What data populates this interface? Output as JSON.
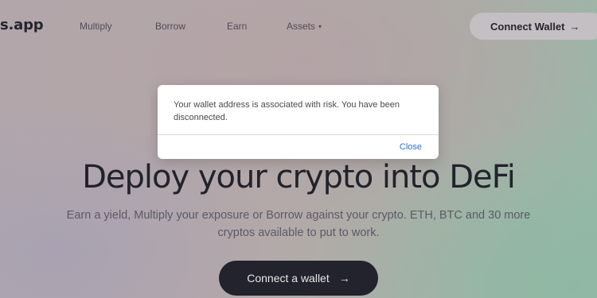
{
  "nav": {
    "logo": "s.app",
    "links": [
      "Multiply",
      "Borrow",
      "Earn",
      "Assets"
    ],
    "connect_wallet": "Connect Wallet",
    "connect_arrow": "→",
    "assets_chevron": "▾"
  },
  "hero": {
    "title": "Deploy your crypto into DeFi",
    "subtitle": "Earn a yield, Multiply your exposure or Borrow against your crypto. ETH, BTC and 30 more cryptos available to put to work.",
    "cta": "Connect a wallet",
    "cta_arrow": "→"
  },
  "modal": {
    "message": "Your wallet address is associated with risk. You have been disconnected.",
    "close": "Close"
  }
}
